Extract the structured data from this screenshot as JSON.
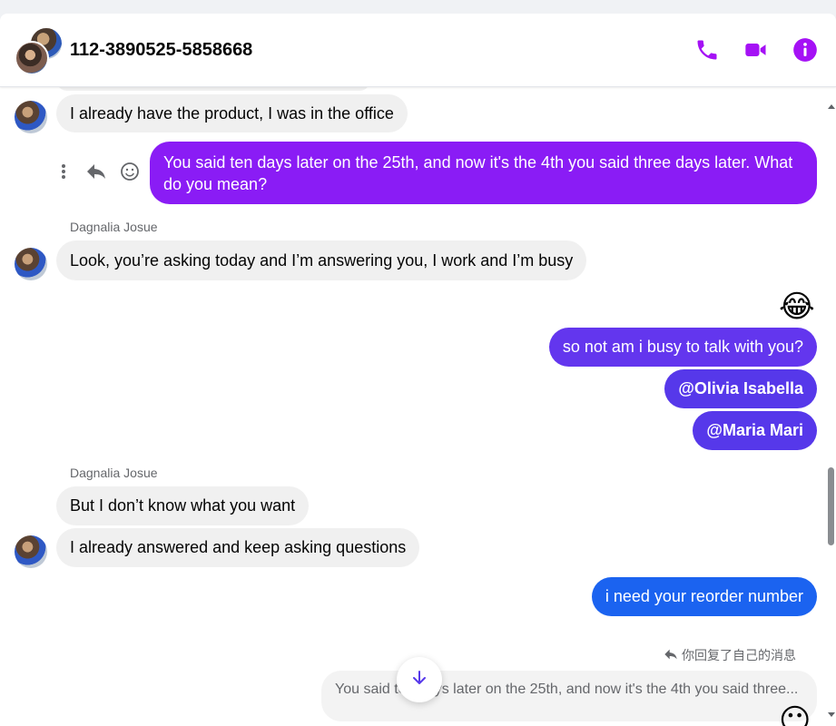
{
  "conversation": {
    "title": "112-3890525-5858668"
  },
  "header": {
    "icons": [
      "phone-icon",
      "video-icon",
      "info-icon"
    ],
    "accent_color": "#a511f5"
  },
  "messages": [
    {
      "id": "m1",
      "direction": "incoming",
      "text": "I already have the product, I was in the office"
    },
    {
      "id": "m2",
      "direction": "outgoing",
      "text": "You said ten days later on the 25th, and now it's the 4th you said three days later. What do you mean?"
    },
    {
      "id": "m3",
      "direction": "incoming",
      "sender": "Dagnalia Josue",
      "text": "Look, you’re asking today and I’m answering you, I work and I’m busy"
    },
    {
      "id": "m4",
      "direction": "outgoing",
      "emoji": "😂"
    },
    {
      "id": "m5",
      "direction": "outgoing",
      "text": "so not am i busy to talk with you?"
    },
    {
      "id": "m6",
      "direction": "outgoing",
      "text": "@Olivia Isabella"
    },
    {
      "id": "m7",
      "direction": "outgoing",
      "text": "@Maria Mari"
    },
    {
      "id": "m8",
      "direction": "incoming",
      "sender": "Dagnalia Josue",
      "text": "But I don’t know what you want"
    },
    {
      "id": "m9",
      "direction": "incoming",
      "text": "I already answered and keep asking questions"
    },
    {
      "id": "m10",
      "direction": "outgoing",
      "text": "i need your reorder number"
    }
  ],
  "reply": {
    "note": "你回复了自己的消息",
    "quoted_text": "You said ten days later on the 25th, and now it's the 4th you said three...",
    "emoji": "😶"
  },
  "message_actions": [
    "more-icon",
    "reply-icon",
    "react-icon"
  ],
  "colors": {
    "incoming_bubble": "#f0f0f0",
    "outgoing_purple": "#8a1cf5",
    "outgoing_indigo": "#6336ee",
    "outgoing_blue": "#1b63f0"
  }
}
